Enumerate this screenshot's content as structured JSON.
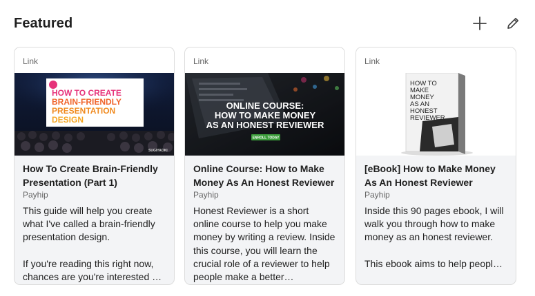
{
  "section": {
    "title": "Featured",
    "add_icon": "plus-icon",
    "edit_icon": "pencil-icon"
  },
  "cards": [
    {
      "type_label": "Link",
      "thumb_title_lines": [
        "HOW TO CREATE",
        "BRAIN-FRIENDLY",
        "PRESENTATION",
        "DESIGN"
      ],
      "thumb_badge": "SUGIYAOKI",
      "title": "How To Create Brain-Friendly Presentation (Part 1)",
      "source": "Payhip",
      "description": "This guide will help you create what I've called a brain-friendly presentation design.\n\nIf you're reading this right now, chances are you're interested …"
    },
    {
      "type_label": "Link",
      "thumb_title_lines": [
        "ONLINE COURSE:",
        "HOW TO MAKE MONEY",
        "AS AN HONEST REVIEWER"
      ],
      "thumb_badge": "ENROLL TODAY",
      "title": "Online Course: How to Make Money As An Honest Reviewer",
      "source": "Payhip",
      "description": "Honest Reviewer is a short online course to help you make money by writing a review. Inside this course, you will learn the crucial role of a reviewer to help people make a better…"
    },
    {
      "type_label": "Link",
      "thumb_title_lines": [
        "HOW TO",
        "MAKE",
        "MONEY",
        "AS AN",
        "HONEST",
        "REVIEWER"
      ],
      "thumb_badge": "",
      "title": "[eBook] How to Make Money As An Honest Reviewer",
      "source": "Payhip",
      "description": "Inside this 90 pages ebook, I will walk you through how to make money as an honest reviewer.\n\nThis ebook aims to help peopl…"
    }
  ]
}
